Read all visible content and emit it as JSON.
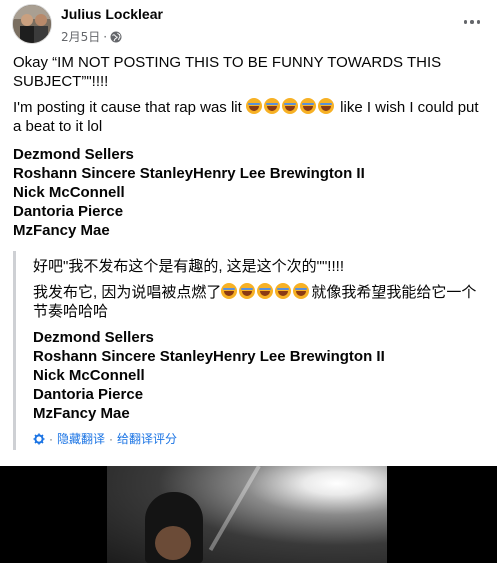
{
  "post": {
    "author": "Julius Locklear",
    "date": "2月5日",
    "privacy_icon": "globe-icon",
    "more_icon": "more-options-icon"
  },
  "original": {
    "line1": "Okay “IM NOT POSTING THIS TO BE FUNNY TOWARDS THIS SUBJECT”\"!!!!",
    "line2_text": "I'm posting it cause that rap was lit",
    "line2_emoji_count": 5,
    "line2_tail": " like I wish I could put a beat to it lol",
    "tags": [
      "Dezmond Sellers",
      "Roshann Sincere StanleyHenry Lee Brewington II",
      "Nick McConnell",
      "Dantoria Pierce",
      "MzFancy Mae"
    ]
  },
  "translation": {
    "line1": "好吧\"我不发布这个是有趣的, 这是这个次的\"\"!!!!",
    "line2_text": "我发布它, 因为说唱被点燃了",
    "line2_emoji_count": 5,
    "line2_tail": "就像我希望我能给它一个节奏哈哈哈",
    "tags": [
      "Dezmond Sellers",
      "Roshann Sincere StanleyHenry Lee Brewington II",
      "Nick McConnell",
      "Dantoria Pierce",
      "MzFancy Mae"
    ],
    "hide_label": "隐藏翻译",
    "separator": "·",
    "rate_label": "给翻译评分",
    "settings_icon": "gear-icon"
  },
  "colors": {
    "link": "#1b74e4",
    "muted": "#65676b",
    "text": "#050505",
    "quote_bar": "#ced0d4"
  }
}
